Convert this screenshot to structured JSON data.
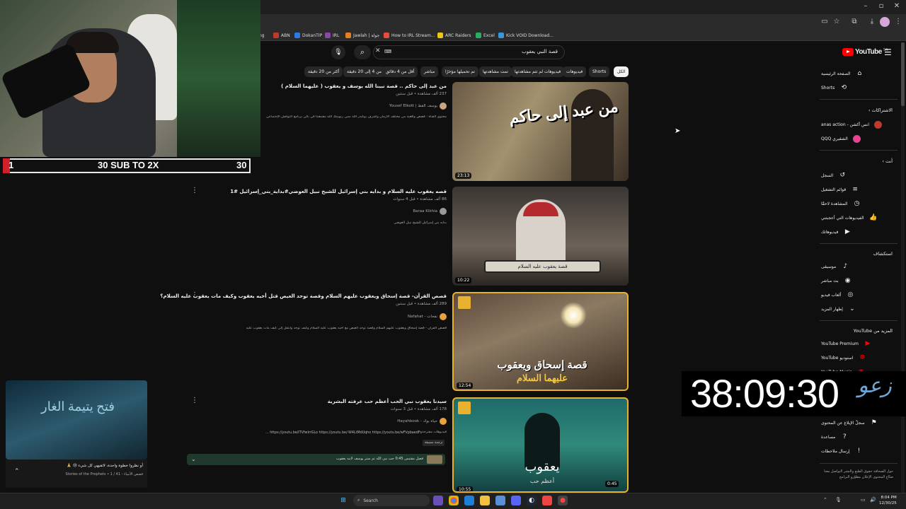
{
  "browser": {
    "bookmarks": [
      {
        "label": "ng",
        "color": "#888888"
      },
      {
        "label": "ABN",
        "color": "#c0392b"
      },
      {
        "label": "DokanTIP",
        "color": "#2c7be5"
      },
      {
        "label": "IRL",
        "color": "#8e44ad"
      },
      {
        "label": "Jawlah | جولة",
        "color": "#e67e22"
      },
      {
        "label": "How to IRL Stream...",
        "color": "#e74c3c"
      },
      {
        "label": "ARC Raiders",
        "color": "#f1c40f"
      },
      {
        "label": "Excel",
        "color": "#27ae60"
      },
      {
        "label": "Kick VOID Download...",
        "color": "#3498db"
      }
    ]
  },
  "webcam": {
    "sub_goal": "30 SUB TO 2X",
    "count_left": "1",
    "count_right": "30"
  },
  "search": {
    "query": "قصة النبي يعقوب"
  },
  "logo": {
    "word": "YouTube",
    "region": "SA"
  },
  "chips": [
    "الكل",
    "Shorts",
    "فيديوهات",
    "فيديوهات لم تتم مشاهدتها",
    "تمت مشاهدتها",
    "تم تحميلها مؤخرًا",
    "مباشر",
    "أقل من 4 دقائق",
    "من 4 إلى 20 دقيقة",
    "أكثر من 20 دقيقة"
  ],
  "results": [
    {
      "title": "من عبد إلى حاكم .. قصة نبينا الله يوسف و يعقوب ( عليهما السلام )",
      "meta": "237 ألف مشاهدة • قبل سنتين",
      "channel": "Yousef Elkott | يوسف القط",
      "desc": "محتوى القناة : قصص واقعية من مختلف الأزمان وأشرف يوكيدر الله ممن ربوبيتك الله مقتبعتنا في بالي برنامج التواصل الإجتماعي",
      "duration": "23:13",
      "thumb_text": "من عبد إلى حاكم"
    },
    {
      "title": "قصه يعقوب عليه السلام و بدايه بني إسرائيل للشيخ نبيل العوضي#بداية_بني_إسرائيل #1",
      "meta": "86 ألف مشاهدة • قبل 4 سنوات",
      "channel": "Baraa Kikhia",
      "desc": "بدايه بني إسرائيل للشيخ نبيل العوضي",
      "duration": "10:22",
      "thumb_text": "قصة يعقوب عليه السلام"
    },
    {
      "title": "قصص القرآن- قصة إسحاق ويعقوب عليهم السلام وقصة توحد العيص قتل أخيه يعقوب وكيف مات يعقوب عليه السلام؟",
      "meta": "289 ألف مشاهدة • قبل سنتين",
      "channel": "Nafahat - نفحات",
      "desc": "قصص القرآن - قصة إسحاق ويعقوب عليهم السلام وقصة توحد العيص مع أخيه يعقوب عليه السلام وكيف توحد وانتقل إلى كيف مات يعقوب عليه",
      "duration": "12:54",
      "thumb_text": "قصة إسحاق ويعقوب",
      "thumb_sub": "عليهما السلام"
    },
    {
      "title": "سيدنا يعقوب نبي الحب أعظم حب عرفته البشرية",
      "meta": "178 ألف مشاهدة • قبل 3 سنوات",
      "channel": "Hayahbook - حياة بوك",
      "desc": "فيديوهات مقترحة",
      "links": "https://youtu.be/ITVfwIrrGLo https://youtu.be/-W4LtMdUqho https://youtu.be/wFVpbaedFs ...",
      "badge": "ترجمة مسبقة",
      "duration": "10:55",
      "thumb_text": "يعقوب",
      "thumb_sub": "أعظم حب",
      "thumb_time2": "0:45"
    }
  ],
  "chapter": {
    "label": "فصل مقتبس",
    "time": "0:45",
    "text": "حب نبي الله تم ستر يوسف لابنه يعقوب"
  },
  "sidebar": {
    "main": [
      {
        "label": "الصفحة الرئيسية",
        "icon": "home-icon"
      },
      {
        "label": "Shorts",
        "icon": "shorts-icon"
      }
    ],
    "subs_title": "الاشتراكات",
    "subs": [
      {
        "label": "انس أكشن - anas action",
        "color": "#c0392b"
      },
      {
        "label": "الشقيري QQQ",
        "color": "#e84393"
      }
    ],
    "you_title": "أنت",
    "you": [
      {
        "label": "السجل",
        "icon": "history-icon"
      },
      {
        "label": "قوائم التشغيل",
        "icon": "playlist-icon"
      },
      {
        "label": "المشاهدة لاحقًا",
        "icon": "clock-icon"
      },
      {
        "label": "الفيديوهات التي أعجبتني",
        "icon": "like-icon"
      },
      {
        "label": "فيديوهاتك",
        "icon": "your-videos-icon"
      }
    ],
    "explore_title": "استكشاف",
    "explore": [
      {
        "label": "موسيقى",
        "icon": "music-icon"
      },
      {
        "label": "بث مباشر",
        "icon": "live-icon"
      },
      {
        "label": "ألعاب فيديو",
        "icon": "gaming-icon"
      },
      {
        "label": "إظهار المزيد",
        "icon": "chevron-down-icon"
      }
    ],
    "more_title": "المزيد من YouTube",
    "more": [
      {
        "label": "YouTube Premium",
        "color": "#ff0000"
      },
      {
        "label": "استوديو YouTube",
        "color": "#ff0000"
      },
      {
        "label": "YouTube Music",
        "color": "#ff0000"
      }
    ],
    "settings": [
      {
        "label": "سجلّ الإبلاغ عن المحتوى",
        "icon": "flag-icon"
      },
      {
        "label": "مساعدة",
        "icon": "help-icon"
      },
      {
        "label": "إرسال ملاحظات",
        "icon": "feedback-icon"
      }
    ],
    "footer": "حول   الصحافة   حقوق الطبع والنشر   التواصل معنا   صنّاع المحتوى   الإعلان   مطوّرو البرامج"
  },
  "overlays": {
    "timer": "38:09:30",
    "timer_mark": "زعو",
    "mini_player_text": "فتح يتيمة الغار",
    "episode_title": "أو نظروا خطوة واحدة، لاتقيهي كل شيء 😢 🙏",
    "episode_meta": "قصص الأنبياء - Stories of the Prophets • 1 / 41"
  },
  "taskbar": {
    "search_label": "Search",
    "time": "8:04 PM",
    "date": "12/30/25"
  }
}
